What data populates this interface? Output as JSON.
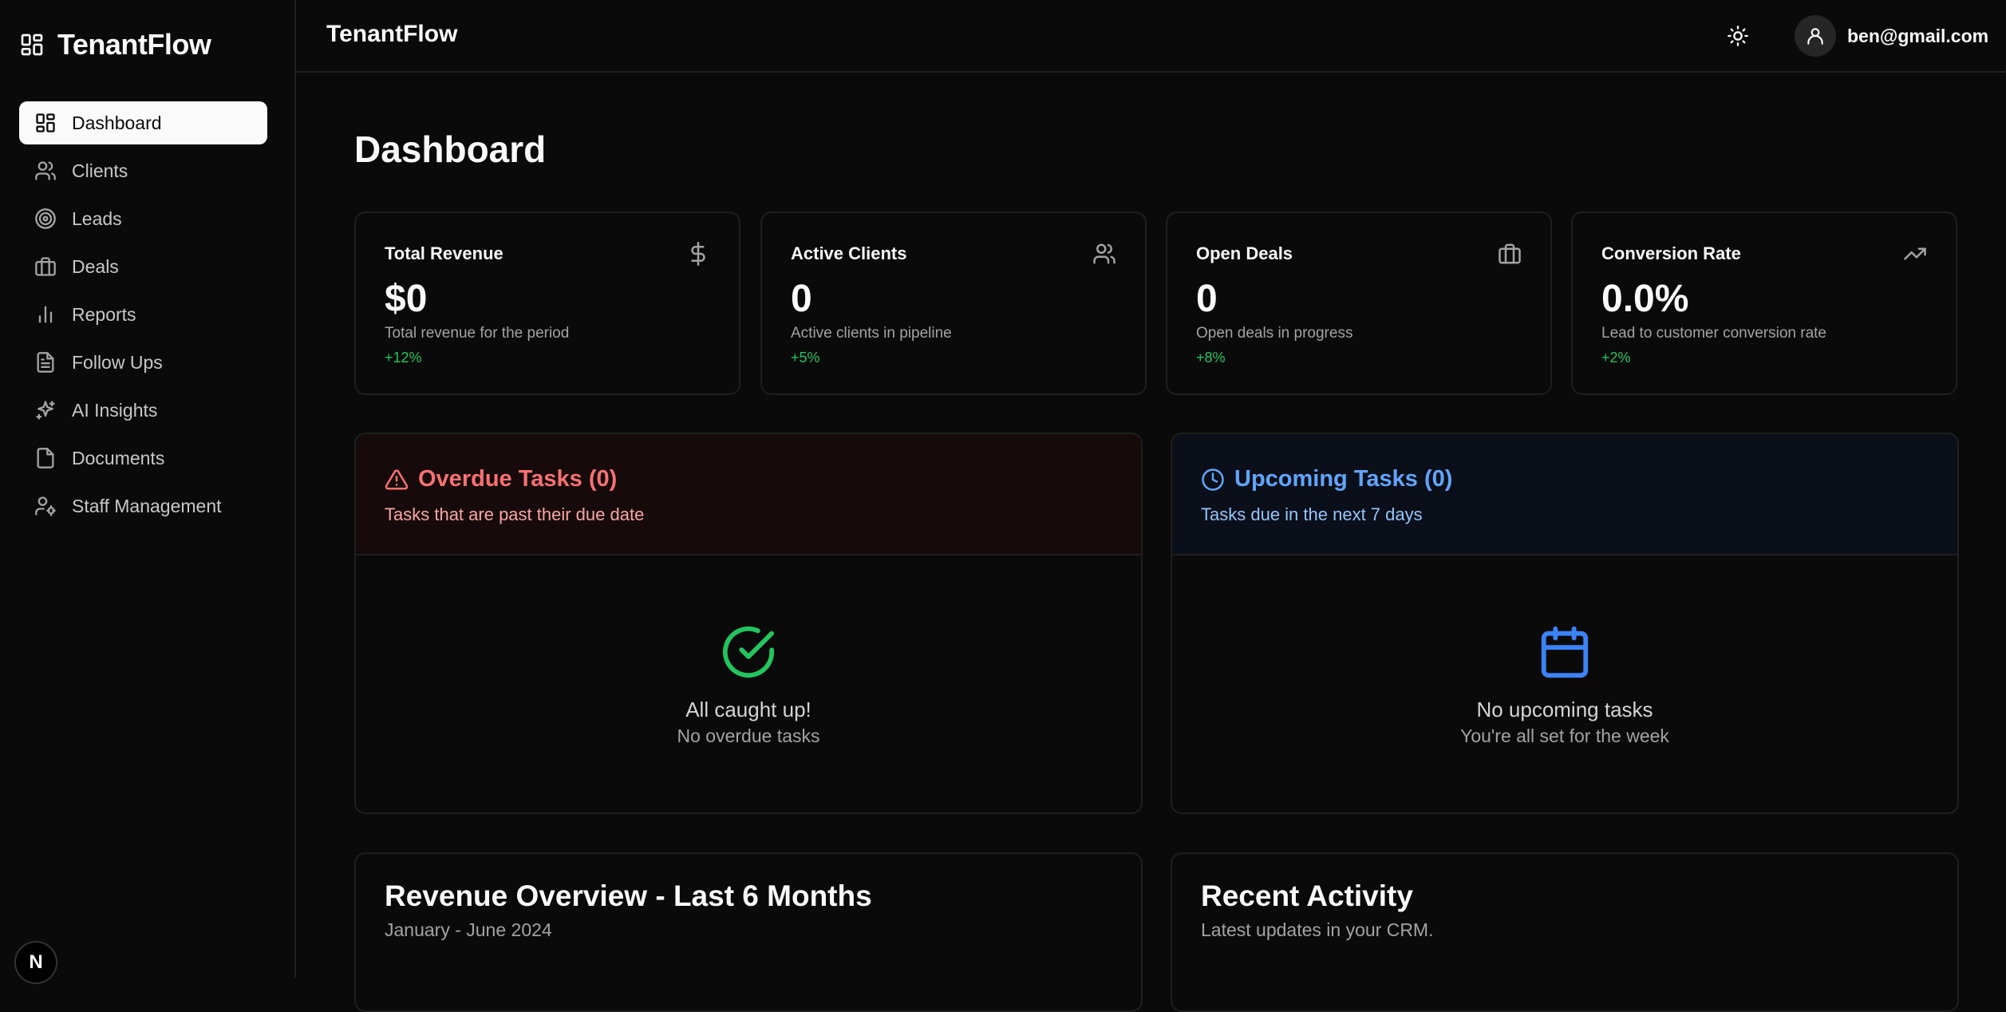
{
  "sidebar": {
    "brand": "TenantFlow",
    "items": [
      {
        "label": "Dashboard",
        "icon": "dashboard-icon",
        "active": true
      },
      {
        "label": "Clients",
        "icon": "users-icon"
      },
      {
        "label": "Leads",
        "icon": "target-icon"
      },
      {
        "label": "Deals",
        "icon": "briefcase-icon"
      },
      {
        "label": "Reports",
        "icon": "bar-chart-icon"
      },
      {
        "label": "Follow Ups",
        "icon": "document-icon"
      },
      {
        "label": "AI Insights",
        "icon": "sparkles-icon"
      },
      {
        "label": "Documents",
        "icon": "file-icon"
      },
      {
        "label": "Staff Management",
        "icon": "user-cog-icon"
      }
    ],
    "next_badge": "N"
  },
  "header": {
    "title": "TenantFlow",
    "user_email": "ben@gmail.com"
  },
  "main": {
    "page_title": "Dashboard",
    "stats": [
      {
        "label": "Total Revenue",
        "value": "$0",
        "desc": "Total revenue for the period",
        "change": "+12%",
        "icon": "dollar-icon"
      },
      {
        "label": "Active Clients",
        "value": "0",
        "desc": "Active clients in pipeline",
        "change": "+5%",
        "icon": "users-icon"
      },
      {
        "label": "Open Deals",
        "value": "0",
        "desc": "Open deals in progress",
        "change": "+8%",
        "icon": "briefcase-icon"
      },
      {
        "label": "Conversion Rate",
        "value": "0.0%",
        "desc": "Lead to customer conversion rate",
        "change": "+2%",
        "icon": "trending-up-icon"
      }
    ],
    "overdue": {
      "title": "Overdue Tasks (0)",
      "subtitle": "Tasks that are past their due date",
      "empty_title": "All caught up!",
      "empty_sub": "No overdue tasks"
    },
    "upcoming": {
      "title": "Upcoming Tasks (0)",
      "subtitle": "Tasks due in the next 7 days",
      "empty_title": "No upcoming tasks",
      "empty_sub": "You're all set for the week"
    },
    "revenue": {
      "title": "Revenue Overview - Last 6 Months",
      "subtitle": "January - June 2024"
    },
    "activity": {
      "title": "Recent Activity",
      "subtitle": "Latest updates in your CRM."
    }
  },
  "colors": {
    "background": "#0a0a0a",
    "border": "#1f1f1f",
    "positive": "#22c55e",
    "overdue": "#f87171",
    "upcoming": "#60a5fa"
  }
}
